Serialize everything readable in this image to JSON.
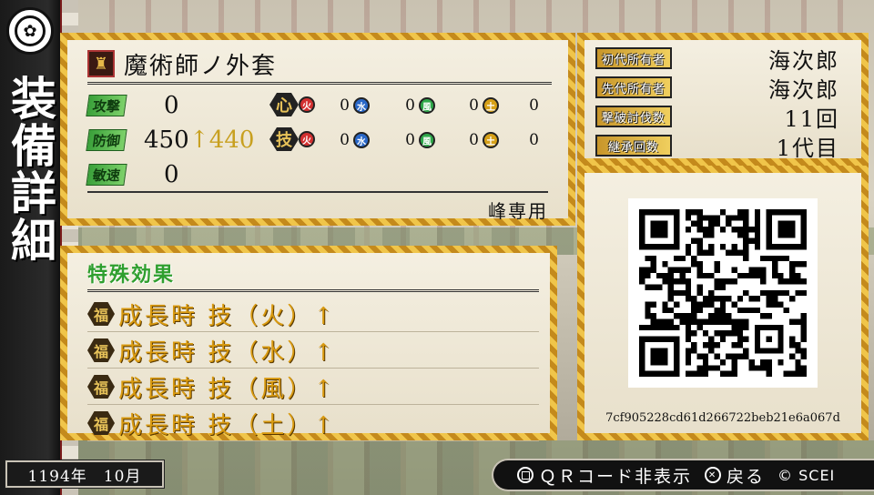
{
  "sidebar": {
    "crest_icon": "family-crest-icon",
    "title": "装備詳細"
  },
  "item": {
    "icon": "armor-icon",
    "name": "魔術師ノ外套",
    "exclusive": "峰専用",
    "stats": [
      {
        "label": "攻撃",
        "value": "0",
        "bonus": ""
      },
      {
        "label": "防御",
        "value": "450",
        "bonus": "↑440"
      },
      {
        "label": "敏速",
        "value": "0",
        "bonus": ""
      }
    ],
    "elements": {
      "kokoro_label": "心",
      "waza_label": "技",
      "kokoro": [
        {
          "name": "火",
          "value": "0"
        },
        {
          "name": "水",
          "value": "0"
        },
        {
          "name": "風",
          "value": "0"
        },
        {
          "name": "土",
          "value": "0"
        }
      ],
      "waza": [
        {
          "name": "火",
          "value": "0"
        },
        {
          "name": "水",
          "value": "0"
        },
        {
          "name": "風",
          "value": "0"
        },
        {
          "name": "土",
          "value": "0"
        }
      ]
    }
  },
  "owner": {
    "rows": [
      {
        "label": "初代所有者",
        "value": "海次郎"
      },
      {
        "label": "先代所有者",
        "value": "海次郎"
      },
      {
        "label": "撃破討伐数",
        "value": "11回"
      },
      {
        "label": "継承回数",
        "value": "1代目"
      }
    ]
  },
  "special": {
    "title": "特殊効果",
    "badge": "福",
    "effects": [
      "成長時 技（火）↑",
      "成長時 技（水）↑",
      "成長時 技（風）↑",
      "成長時 技（土）↑"
    ]
  },
  "qr": {
    "hash": "7cf905228cd61d266722beb21e6a067d"
  },
  "footer": {
    "date": "1194年　10月",
    "qr_toggle_label": "ＱＲコード非表示",
    "back_label": "戻る",
    "copyright": "© SCEI"
  },
  "colors": {
    "gold_frame": "#e2b43a",
    "effect_text": "#d99a10",
    "special_title": "#2f9f2f",
    "stat_bonus": "#c8a020"
  }
}
